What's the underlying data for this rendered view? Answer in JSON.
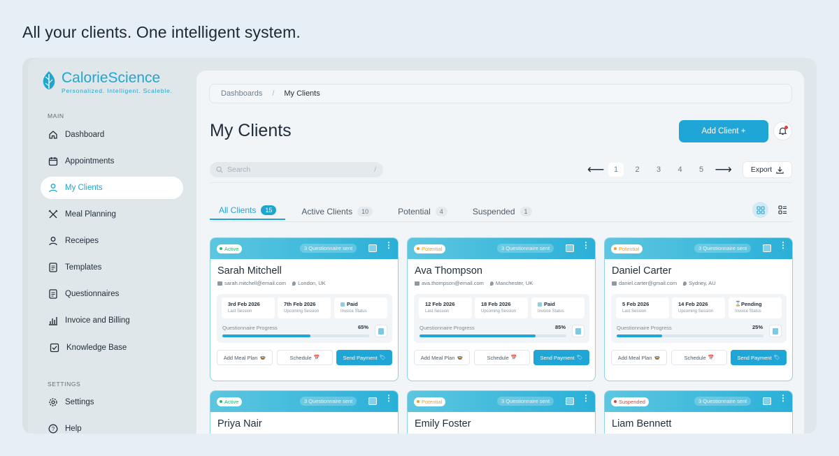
{
  "headline": "All your clients. One intelligent system.",
  "brand": {
    "name": "CalorieScience",
    "tagline": "Personalized. Intelligent. Scaleble."
  },
  "sidebar": {
    "main_label": "MAIN",
    "settings_label": "SETTINGS",
    "items": [
      {
        "label": "Dashboard",
        "icon": "home-icon"
      },
      {
        "label": "Appointments",
        "icon": "calendar-icon"
      },
      {
        "label": "My Clients",
        "icon": "user-icon",
        "active": true
      },
      {
        "label": "Meal Planning",
        "icon": "utensils-icon"
      },
      {
        "label": "Receipes",
        "icon": "user-icon"
      },
      {
        "label": "Templates",
        "icon": "document-icon"
      },
      {
        "label": "Questionnaires",
        "icon": "document-icon"
      },
      {
        "label": "Invoice and Billing",
        "icon": "bar-chart-icon"
      },
      {
        "label": "Knowledge Base",
        "icon": "checkbox-icon"
      }
    ],
    "settings_items": [
      {
        "label": "Settings",
        "icon": "gear-icon"
      },
      {
        "label": "Help",
        "icon": "help-icon"
      }
    ]
  },
  "breadcrumb": {
    "parent": "Dashboards",
    "separator": "/",
    "current": "My Clients"
  },
  "page_title": "My Clients",
  "add_client_label": "Add Client +",
  "search": {
    "placeholder": "Search",
    "shortcut": "/"
  },
  "pagination": {
    "pages": [
      "1",
      "2",
      "3",
      "4",
      "5"
    ],
    "current": "1",
    "prev": "⟵",
    "next": "⟶"
  },
  "export_label": "Export",
  "tabs": [
    {
      "label": "All Clients",
      "count": "15",
      "active": true
    },
    {
      "label": "Active Clients",
      "count": "10"
    },
    {
      "label": "Potential",
      "count": "4"
    },
    {
      "label": "Suspended",
      "count": "1"
    }
  ],
  "colors": {
    "accent": "#1fa6d6",
    "active": "#2bb673",
    "potential": "#f0a020",
    "suspended": "#e0413a"
  },
  "card_common": {
    "q_sent": "3 Questionnaire sent",
    "last_session_label": "Last Session",
    "upcoming_label": "Upcoming Session",
    "invoice_label": "Invoice Status",
    "progress_label": "Questionnaire Progress",
    "meal_plan_label": "Add Meal Plan",
    "schedule_label": "Schedule",
    "payment_label": "Send Payment"
  },
  "clients": [
    {
      "status": "Active",
      "name": "Sarah Mitchell",
      "email": "sarah.mitchell@email.com",
      "location": "London, UK",
      "last": "3rd Feb 2026",
      "upcoming": "7th Feb 2026",
      "invoice": "Paid",
      "progress": "65%"
    },
    {
      "status": "Potential",
      "name": "Ava Thompson",
      "email": "ava.thompson@email.com",
      "location": "Manchester, UK",
      "last": "12 Feb 2026",
      "upcoming": "18 Feb 2026",
      "invoice": "Paid",
      "progress": "85%"
    },
    {
      "status": "Potential",
      "name": "Daniel Carter",
      "email": "daniel.carter@gmail.com",
      "location": "Sydney, AU",
      "last": "5 Feb 2026",
      "upcoming": "14 Feb 2026",
      "invoice": "Pending",
      "progress": "25%"
    },
    {
      "status": "Active",
      "name": "Priya Nair"
    },
    {
      "status": "Potential",
      "name": "Emily Foster"
    },
    {
      "status": "Suspended",
      "name": "Liam Bennett"
    }
  ]
}
